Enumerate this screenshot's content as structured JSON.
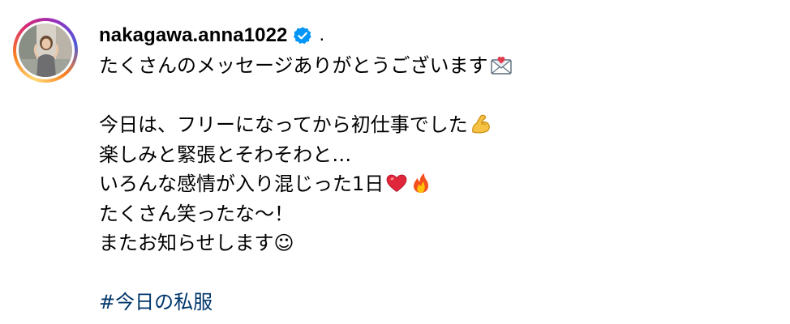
{
  "post": {
    "username": "nakagawa.anna1022",
    "separator": ".",
    "verified": true,
    "avatar_ring_colors": [
      "#feda75",
      "#fa7e1e",
      "#d62976",
      "#962fbf",
      "#4f5bd5"
    ],
    "verified_color": "#0095f6",
    "hashtag_color": "#00376b"
  },
  "caption": {
    "line1": "たくさんのメッセージありがとうございます",
    "line1_emoji": "love-letter-icon",
    "line2": "今日は、フリーになってから初仕事でした",
    "line2_emoji": "flexed-biceps-icon",
    "line3": "楽しみと緊張とそわそわと…",
    "line4": "いろんな感情が入り混じった1日",
    "line4_emojis": [
      "red-heart-icon",
      "fire-icon"
    ],
    "line5": "たくさん笑ったな〜！",
    "line6": "またお知らせします☺︎",
    "hashtag": "#今日の私服"
  }
}
